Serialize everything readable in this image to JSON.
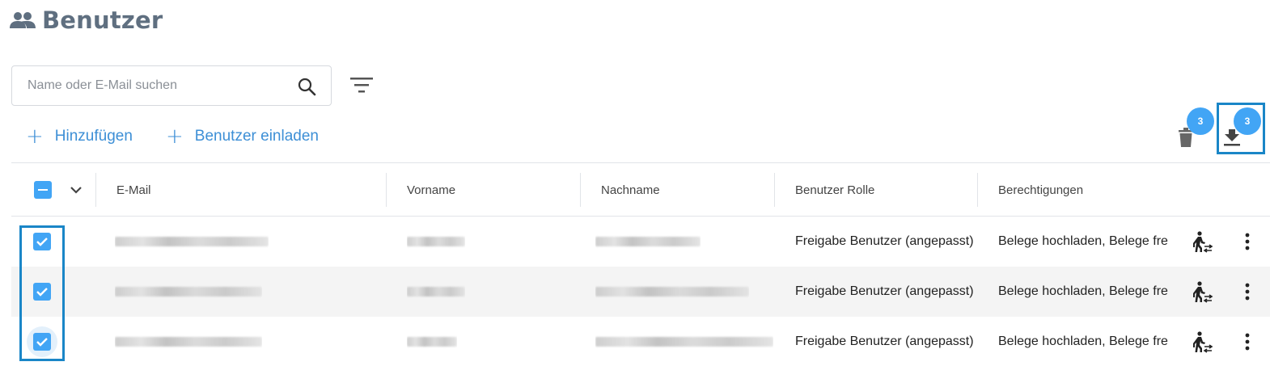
{
  "header": {
    "title": "Benutzer",
    "icon": "users-icon"
  },
  "search": {
    "placeholder": "Name oder E-Mail suchen",
    "value": ""
  },
  "actions": {
    "add_label": "Hinzufügen",
    "invite_label": "Benutzer einladen"
  },
  "toolbar": {
    "delete_badge": "3",
    "download_badge": "3"
  },
  "table": {
    "columns": [
      "E-Mail",
      "Vorname",
      "Nachname",
      "Benutzer Rolle",
      "Berechtigungen"
    ],
    "rows": [
      {
        "role": "Freigabe Benutzer (angepasst)",
        "permissions": "Belege hochladen, Belege fre",
        "checked": true
      },
      {
        "role": "Freigabe Benutzer (angepasst)",
        "permissions": "Belege hochladen, Belege fre",
        "checked": true
      },
      {
        "role": "Freigabe Benutzer (angepasst)",
        "permissions": "Belege hochladen, Belege fre",
        "checked": true
      }
    ]
  },
  "colors": {
    "accent": "#42a5f5",
    "link": "#3d8fd6",
    "highlight": "#1a86c7",
    "title": "#5f6f80"
  }
}
